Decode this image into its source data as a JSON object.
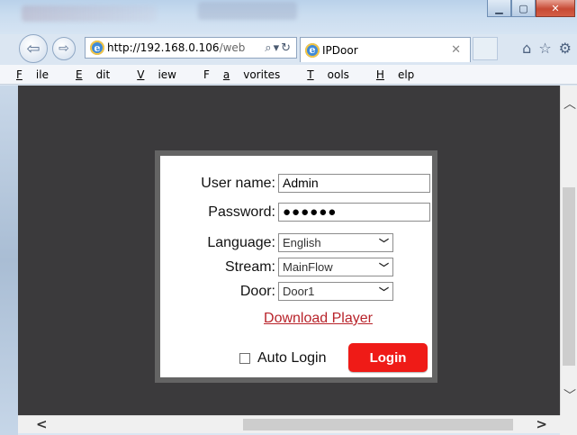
{
  "browser": {
    "url_host": "http://192.168.0.106",
    "url_rest": "/web",
    "tab_title": "IPDoor",
    "window_controls": [
      "minimize",
      "maximize",
      "close"
    ]
  },
  "menu": [
    {
      "label": "File",
      "key": "F",
      "rest": "ile"
    },
    {
      "label": "Edit",
      "key": "E",
      "rest": "dit"
    },
    {
      "label": "View",
      "key": "V",
      "rest": "iew"
    },
    {
      "label": "Favorites",
      "pre": "F",
      "key": "a",
      "rest": "vorites"
    },
    {
      "label": "Tools",
      "key": "T",
      "rest": "ools"
    },
    {
      "label": "Help",
      "key": "H",
      "rest": "elp"
    }
  ],
  "login": {
    "username_label": "User name:",
    "username_value": "Admin",
    "password_label": "Password:",
    "password_mask": "●●●●●●",
    "language_label": "Language:",
    "language_value": "English",
    "stream_label": "Stream:",
    "stream_value": "MainFlow",
    "door_label": "Door:",
    "door_value": "Door1",
    "download_link": "Download Player",
    "auto_login_label": "Auto Login",
    "auto_login_checked": false,
    "login_button": "Login"
  },
  "colors": {
    "page_background": "#3b3a3c",
    "panel_border": "#646464",
    "login_button": "#ef1b17",
    "link": "#b8232a"
  },
  "icons": {
    "back": "back-arrow-icon",
    "forward": "forward-arrow-icon",
    "search": "search-icon",
    "refresh": "refresh-icon",
    "home": "home-icon",
    "favorites": "star-icon",
    "settings": "gear-icon"
  }
}
